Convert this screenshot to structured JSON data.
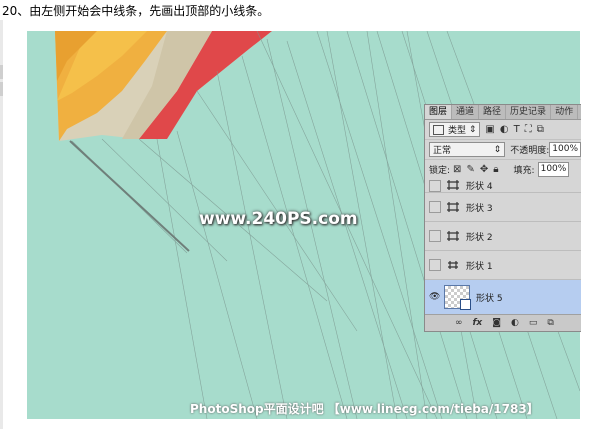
{
  "instruction": "20、由左侧开始会中线条，先画出顶部的小线条。",
  "watermark": "www.240PS.com",
  "footer": "PhotoShop平面设计吧 【www.linecg.com/tieba/1783】",
  "panel": {
    "tabs": [
      "图层",
      "通道",
      "路径",
      "历史记录",
      "动作"
    ],
    "active_tab": "图层",
    "filter_label": "类型",
    "blend_mode": "正常",
    "opacity_label": "不透明度:",
    "opacity_value": "100%",
    "lock_label": "锁定:",
    "fill_label": "填充:",
    "fill_value": "100%",
    "layers": [
      {
        "name": "形状 4"
      },
      {
        "name": "形状 3"
      },
      {
        "name": "形状 2"
      },
      {
        "name": "形状 1"
      },
      {
        "name": "形状 5"
      }
    ],
    "bottom_icons": [
      "link-icon",
      "fx-icon",
      "mask-icon",
      "adjustment-icon",
      "folder-icon",
      "new-layer-icon"
    ],
    "fx_label": "fx"
  },
  "colors": {
    "scene_bg": "#a7dccc",
    "selected_layer": "#b6cdf0"
  }
}
